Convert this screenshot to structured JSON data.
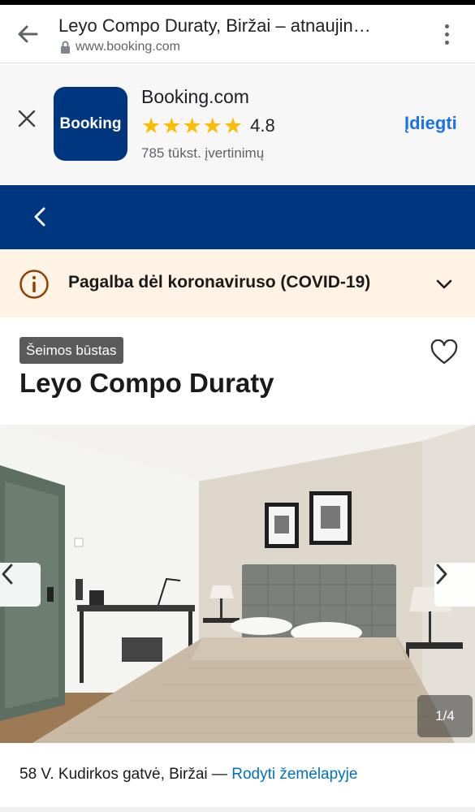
{
  "browser": {
    "page_title": "Leyo Compo Duraty, Biržai – atnaujin…",
    "url": "www.booking.com",
    "back_icon": "arrow-left-icon",
    "menu_icon": "more-vert-icon"
  },
  "app_banner": {
    "logo_text": "Booking",
    "app_name": "Booking.com",
    "rating": "4.8",
    "reviews": "785 tūkst. įvertinimų",
    "install_label": "Įdiegti",
    "star_color": "#fbbc04",
    "brand_color": "#003580"
  },
  "nav": {
    "back_icon": "chevron-left-icon",
    "bg_color": "#003580"
  },
  "covid_banner": {
    "text": "Pagalba dėl koronaviruso (COVID-19)",
    "icon": "info-icon",
    "bg_color": "#fef3e5"
  },
  "property": {
    "badge": "Šeimos būstas",
    "name": "Leyo Compo Duraty",
    "photo_counter": "1/4",
    "address": "58 V. Kudirkos gatvė, Biržai",
    "separator": " — ",
    "map_link": "Rodyti žemėlapyje",
    "link_color": "#0071c2"
  }
}
